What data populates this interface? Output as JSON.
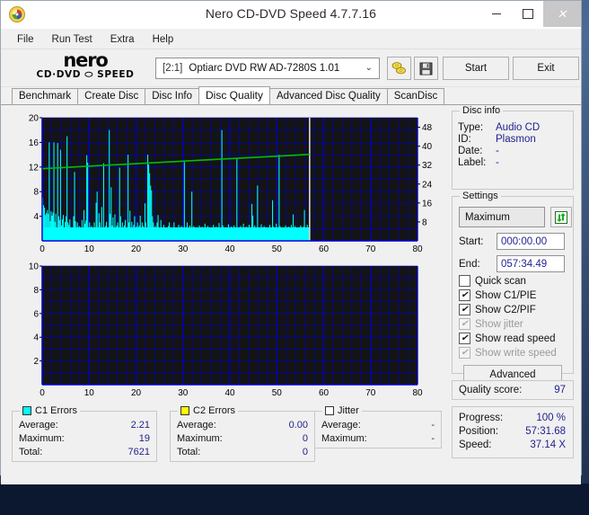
{
  "window": {
    "title": "Nero CD-DVD Speed 4.7.7.16",
    "icon": "nero-logo-icon",
    "minimize": "−",
    "maximize": "□",
    "close": "✕"
  },
  "menu": {
    "items": [
      "File",
      "Run Test",
      "Extra",
      "Help"
    ]
  },
  "toolbar": {
    "logo_line1": "nero",
    "logo_line2": "CD·DVD ⬭ SPEED",
    "drive_bus": "[2:1]",
    "drive_name": "Optiarc DVD RW AD-7280S 1.01",
    "dropdown_caret": "⌄",
    "eject_icon": "eject-disc-icon",
    "save_icon": "floppy-save-icon",
    "start_label": "Start",
    "exit_label": "Exit"
  },
  "tabs": {
    "items": [
      "Benchmark",
      "Create Disc",
      "Disc Info",
      "Disc Quality",
      "Advanced Disc Quality",
      "ScanDisc"
    ],
    "active": "Disc Quality"
  },
  "disc_info": {
    "legend": "Disc info",
    "rows": [
      {
        "key": "Type:",
        "value": "Audio CD"
      },
      {
        "key": "ID:",
        "value": "Plasmon"
      },
      {
        "key": "Date:",
        "value": "-"
      },
      {
        "key": "Label:",
        "value": "-"
      }
    ]
  },
  "settings": {
    "legend": "Settings",
    "speed_value": "Maximum",
    "speed_caret": "⌄",
    "refresh_icon": "refresh-arrows-icon",
    "start_key": "Start:",
    "start_value": "000:00.00",
    "end_key": "End:",
    "end_value": "057:34.49",
    "checkboxes": [
      {
        "label": "Quick scan",
        "checked": false,
        "disabled": false
      },
      {
        "label": "Show C1/PIE",
        "checked": true,
        "disabled": false
      },
      {
        "label": "Show C2/PIF",
        "checked": true,
        "disabled": false
      },
      {
        "label": "Show jitter",
        "checked": true,
        "disabled": true
      },
      {
        "label": "Show read speed",
        "checked": true,
        "disabled": false
      },
      {
        "label": "Show write speed",
        "checked": true,
        "disabled": true
      }
    ],
    "check_glyph": "✔",
    "advanced_label": "Advanced"
  },
  "quality": {
    "key": "Quality score:",
    "value": "97"
  },
  "progress": {
    "rows": [
      {
        "key": "Progress:",
        "value": "100 %"
      },
      {
        "key": "Position:",
        "value": "57:31.68"
      },
      {
        "key": "Speed:",
        "value": "37.14 X"
      }
    ]
  },
  "stats": [
    {
      "legend": "C1 Errors",
      "color": "#00ffff",
      "rows": [
        {
          "key": "Average:",
          "value": "2.21"
        },
        {
          "key": "Maximum:",
          "value": "19"
        },
        {
          "key": "Total:",
          "value": "7621"
        }
      ]
    },
    {
      "legend": "C2 Errors",
      "color": "#ffff00",
      "rows": [
        {
          "key": "Average:",
          "value": "0.00"
        },
        {
          "key": "Maximum:",
          "value": "0"
        },
        {
          "key": "Total:",
          "value": "0"
        }
      ]
    },
    {
      "legend": "Jitter",
      "color": "#ffffff",
      "rows": [
        {
          "key": "Average:",
          "value": "-"
        },
        {
          "key": "Maximum:",
          "value": "-"
        }
      ]
    }
  ],
  "chart_data": [
    {
      "type": "area",
      "name": "c1-errors-chart",
      "title": "",
      "xlabel": "",
      "ylabel": "",
      "xlim": [
        0,
        80
      ],
      "xticks": [
        0,
        10,
        20,
        30,
        40,
        50,
        60,
        70,
        80
      ],
      "ylim": [
        0,
        20
      ],
      "yticks": [
        4,
        8,
        12,
        16,
        20
      ],
      "y2lim": [
        0,
        52
      ],
      "y2ticks": [
        8,
        16,
        24,
        32,
        40,
        48
      ],
      "grid": true,
      "plot_bg": "#141414",
      "grid_color": "#0000cc",
      "series_color": "#00ffff",
      "speed_color": "#00c000",
      "data_end_x": 57.0,
      "legend": [
        "C1 Errors",
        "Read speed"
      ],
      "values": [
        7.0,
        5.8,
        5.4,
        4.2,
        4.5,
        5.0,
        4.4,
        16.0,
        3.2,
        4.8,
        4.1,
        4.6,
        16.0,
        3.1,
        4.4,
        2.0,
        15.9,
        4.0,
        3.4,
        14.8,
        2.5,
        3.5,
        4.2,
        2.0,
        3.1,
        4.0,
        17.0,
        3.0,
        2.6,
        3.5,
        1.5,
        2.0,
        1.4,
        4.0,
        11.2,
        3.2,
        2.1,
        3.0,
        1.8,
        2.4,
        1.3,
        2.0,
        3.4,
        1.9,
        5.0,
        2.8,
        3.3,
        13.9,
        12.7,
        2.1,
        3.0,
        1.6,
        2.4,
        1.2,
        2.2,
        3.0,
        1.7,
        6.2,
        8.0,
        2.0,
        4.5,
        3.0,
        2.1,
        5.5,
        2.0,
        12.6,
        1.5,
        2.4,
        3.1,
        1.4,
        2.0,
        18.0,
        4.4,
        8.7,
        2.5,
        3.8,
        2.0,
        4.3,
        1.6,
        2.5,
        3.0,
        1.9,
        11.9,
        4.0,
        2.1,
        3.0,
        1.8,
        2.5,
        3.4,
        1.7,
        2.0,
        14.0,
        3.0,
        4.9,
        2.2,
        3.1,
        1.8,
        2.6,
        4.0,
        1.5,
        2.3,
        3.0,
        1.8,
        2.5,
        4.1,
        1.9,
        3.0,
        2.4,
        1.7,
        6.1,
        3.0,
        2.0,
        14.0,
        12.4,
        11.0,
        9.0,
        8.2,
        4.0,
        3.0,
        2.0,
        2.4,
        1.8,
        3.0,
        4.2,
        1.6,
        2.0,
        3.4,
        1.3,
        2.0,
        2.6,
        1.1,
        1.8,
        2.0,
        1.3,
        2.4,
        3.0,
        1.5,
        2.0,
        1.2,
        1.8,
        3.0,
        1.4,
        2.2,
        1.0,
        1.9,
        2.6,
        1.2,
        1.8,
        2.4,
        1.1,
        2.0,
        12.8,
        1.5,
        2.2,
        3.0,
        1.3,
        1.9,
        2.5,
        1.2,
        8.0,
        1.8,
        2.4,
        1.0,
        1.6,
        2.2,
        1.3,
        1.9,
        2.5,
        1.1,
        1.7,
        2.3,
        1.4,
        2.0,
        2.8,
        1.2,
        1.8,
        2.4,
        1.0,
        1.6,
        2.2,
        1.3,
        1.9,
        2.6,
        1.1,
        1.7,
        2.3,
        1.5,
        2.1,
        2.9,
        1.2,
        1.8,
        18.0,
        2.5,
        1.0,
        1.6,
        2.2,
        1.4,
        2.0,
        2.7,
        1.1,
        1.7,
        2.3,
        1.3,
        1.9,
        2.5,
        1.0,
        1.6,
        13.4,
        2.1,
        1.2,
        1.8,
        2.4,
        1.5,
        2.1,
        2.8,
        1.1,
        1.7,
        2.3,
        1.4,
        2.0,
        2.6,
        1.2,
        1.8,
        6.0,
        4.1,
        2.0,
        2.5,
        1.3,
        1.9,
        9.0,
        2.1,
        1.5,
        2.0,
        2.7,
        1.2,
        1.8,
        2.4,
        1.0,
        1.6,
        2.2,
        1.4,
        2.0,
        2.6,
        1.1,
        1.7,
        6.6,
        2.3,
        1.5,
        2.1,
        2.8,
        1.2,
        1.8,
        14.0,
        2.4,
        1.0,
        1.6,
        2.2,
        1.3,
        1.9,
        2.5,
        1.1,
        1.7,
        2.3,
        1.4,
        2.0,
        2.6,
        1.2,
        4.3,
        1.8,
        2.4,
        1.0,
        1.6,
        2.2,
        1.3,
        1.9,
        2.5,
        1.1,
        1.7,
        2.3,
        5.0,
        1.4,
        2.0,
        2.6,
        1.2,
        1.8
      ],
      "speed_line": [
        {
          "x": 0,
          "y": 30.5
        },
        {
          "x": 57,
          "y": 36.5
        }
      ]
    },
    {
      "type": "area",
      "name": "c2-errors-chart",
      "title": "",
      "xlabel": "",
      "ylabel": "",
      "xlim": [
        0,
        80
      ],
      "xticks": [
        0,
        10,
        20,
        30,
        40,
        50,
        60,
        70,
        80
      ],
      "ylim": [
        0,
        10
      ],
      "yticks": [
        2,
        4,
        6,
        8,
        10
      ],
      "grid": true,
      "plot_bg": "#141414",
      "grid_color": "#0000cc",
      "series_color": "#ffff00",
      "values": []
    }
  ]
}
